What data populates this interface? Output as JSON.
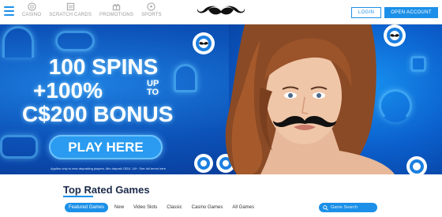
{
  "header": {
    "nav": [
      {
        "label": "CASINO",
        "icon": "casino-chip-icon"
      },
      {
        "label": "SCRATCH CARDS",
        "icon": "scratch-card-icon"
      },
      {
        "label": "PROMOTIONS",
        "icon": "gift-icon"
      },
      {
        "label": "SPORTS",
        "icon": "soccer-ball-icon"
      }
    ],
    "login_label": "LOGIN",
    "open_account_label": "OPEN ACCOUNT"
  },
  "banner": {
    "line1": "100 SPINS",
    "line2": "+100%",
    "up_to_1": "UP",
    "up_to_2": "TO",
    "line3": "C$200 BONUS",
    "cta_label": "PLAY HERE",
    "terms": "Applies only to new depositing players. Min deposit C$10. 18+. See full terms here"
  },
  "games": {
    "title": "Top Rated Games",
    "tabs": [
      "Featured Games",
      "New",
      "Video Slots",
      "Classic",
      "Casino Games",
      "All Games"
    ],
    "active_tab": "Featured Games",
    "search_placeholder": "Game Search"
  },
  "colors": {
    "accent": "#1c90e8",
    "banner_dark": "#07318a",
    "title": "#1b2a4a"
  }
}
